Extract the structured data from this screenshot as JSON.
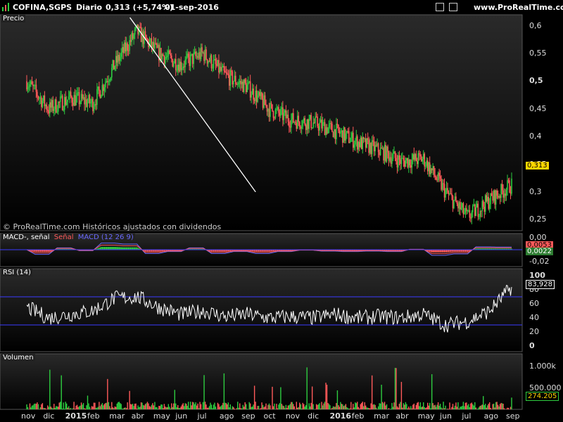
{
  "header": {
    "ticker": "COFINA,SGPS",
    "period": "Diario",
    "quote": "0,313 (+5,74%)",
    "date": "01-sep-2016",
    "site": "www.ProRealTime.com"
  },
  "panels": {
    "price_label": "Precio",
    "price_footer": "© ProRealTime.com  Históricos ajustados con dividendos",
    "macd_label_1": "MACD-, señal",
    "macd_label_2": "Señal",
    "macd_label_3": "MACD (12 26 9)",
    "rsi_label": "RSI (14)",
    "vol_label": "Volumen"
  },
  "price_axis": [
    "0,6",
    "0,55",
    "0,5",
    "0,45",
    "0,4",
    "0,35",
    "0,3",
    "0,25"
  ],
  "macd_axis": [
    "0,00",
    "-0,02"
  ],
  "rsi_axis": [
    "100",
    "80",
    "60",
    "40",
    "20",
    "0"
  ],
  "vol_axis": [
    "1.000k",
    "500.000"
  ],
  "last_values": {
    "price": "0,313",
    "macd_a": "0,0053",
    "macd_b": "0,0022",
    "rsi": "83,928",
    "volume": "274.205"
  },
  "x_axis": [
    "nov",
    "dic",
    "2015",
    "feb",
    "mar",
    "abr",
    "may",
    "jun",
    "jul",
    "ago",
    "sep",
    "oct",
    "nov",
    "dic",
    "2016",
    "feb",
    "mar",
    "abr",
    "may",
    "jun",
    "jul",
    "ago",
    "sep"
  ],
  "colors": {
    "up": "#2ecc40",
    "down": "#ff5a5a",
    "trend": "#ffffff",
    "rsi_band": "#3a3aff",
    "price_tag": "#ffd700"
  },
  "chart_data": {
    "type": "candlestick",
    "title": "COFINA,SGPS",
    "period": "Diario",
    "x_ticks": [
      "nov",
      "dic",
      "2015",
      "feb",
      "mar",
      "abr",
      "may",
      "jun",
      "jul",
      "ago",
      "sep",
      "oct",
      "nov",
      "dic",
      "2016",
      "feb",
      "mar",
      "abr",
      "may",
      "jun",
      "jul",
      "ago",
      "sep"
    ],
    "price_ylim": [
      0.23,
      0.62
    ],
    "price_close_monthly": [
      0.5,
      0.45,
      0.47,
      0.46,
      0.53,
      0.59,
      0.55,
      0.53,
      0.55,
      0.51,
      0.49,
      0.45,
      0.43,
      0.425,
      0.41,
      0.39,
      0.375,
      0.355,
      0.36,
      0.3,
      0.255,
      0.285,
      0.313
    ],
    "trendline": {
      "from": [
        "abr",
        0.615
      ],
      "to": [
        "sep",
        0.3
      ]
    },
    "last_price": 0.313,
    "rsi": {
      "period": 14,
      "ylim": [
        0,
        100
      ],
      "bands": [
        30,
        70
      ],
      "last": 83.928,
      "monthly": [
        55,
        40,
        45,
        50,
        68,
        70,
        55,
        45,
        50,
        42,
        45,
        40,
        42,
        40,
        45,
        40,
        42,
        40,
        45,
        30,
        35,
        50,
        83.928
      ]
    },
    "macd": {
      "params": "12 26 9",
      "last_macd": 0.0053,
      "last_signal": 0.0022
    },
    "volume": {
      "last": 274205,
      "ylim": [
        0,
        1200000
      ]
    }
  }
}
